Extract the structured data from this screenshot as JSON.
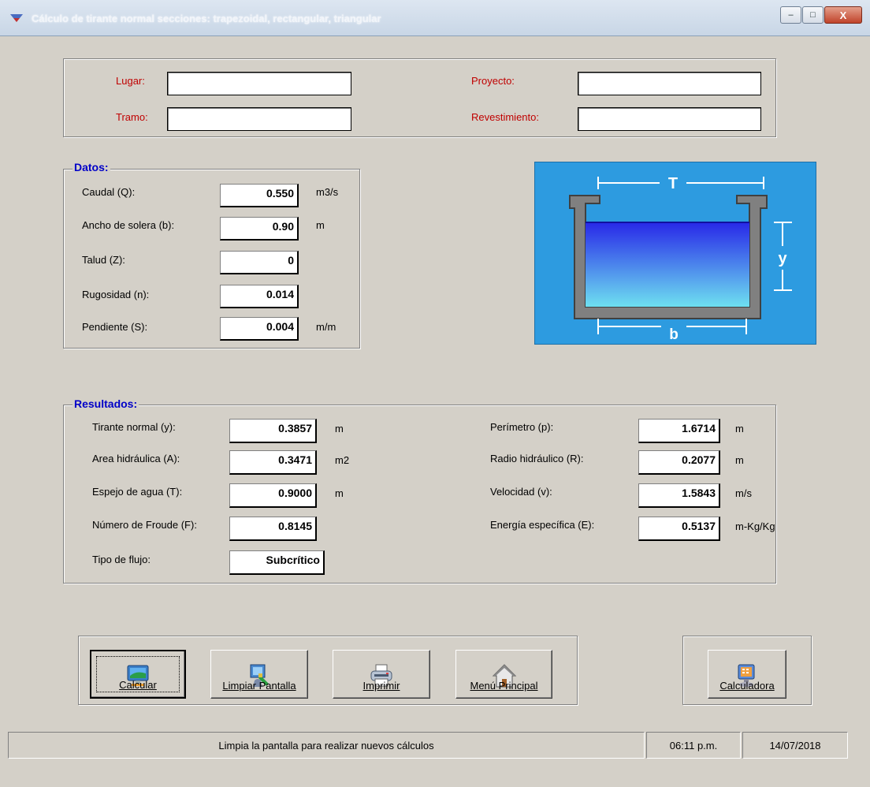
{
  "window": {
    "title": "Cálculo de tirante normal secciones: trapezoidal, rectangular, triangular",
    "minimize": "–",
    "maximize": "□",
    "close": "X"
  },
  "info": {
    "lugar_label": "Lugar:",
    "tramo_label": "Tramo:",
    "proyecto_label": "Proyecto:",
    "revestimiento_label": "Revestimiento:",
    "lugar_value": "",
    "tramo_value": "",
    "proyecto_value": "",
    "revestimiento_value": ""
  },
  "datos": {
    "title": "Datos:",
    "caudal_label": "Caudal (Q):",
    "caudal_value": "0.550",
    "caudal_unit": "m3/s",
    "ancho_label": "Ancho de solera (b):",
    "ancho_value": "0.90",
    "ancho_unit": "m",
    "talud_label": "Talud (Z):",
    "talud_value": "0",
    "rugosidad_label": "Rugosidad (n):",
    "rugosidad_value": "0.014",
    "pendiente_label": "Pendiente (S):",
    "pendiente_value": "0.004",
    "pendiente_unit": "m/m"
  },
  "diagram": {
    "top_label": "T",
    "depth_label": "y",
    "bottom_label": "b"
  },
  "resultados": {
    "title": "Resultados:",
    "tirante_label": "Tirante normal (y):",
    "tirante_value": "0.3857",
    "tirante_unit": "m",
    "area_label": "Area hidráulica (A):",
    "area_value": "0.3471",
    "area_unit": "m2",
    "espejo_label": "Espejo de agua (T):",
    "espejo_value": "0.9000",
    "espejo_unit": "m",
    "froude_label": "Número de Froude (F):",
    "froude_value": "0.8145",
    "tipo_label": "Tipo de flujo:",
    "tipo_value": "Subcrítico",
    "perimetro_label": "Perímetro (p):",
    "perimetro_value": "1.6714",
    "perimetro_unit": "m",
    "radio_label": "Radio hidráulico (R):",
    "radio_value": "0.2077",
    "radio_unit": "m",
    "velocidad_label": "Velocidad (v):",
    "velocidad_value": "1.5843",
    "velocidad_unit": "m/s",
    "energia_label": "Energía específica (E):",
    "energia_value": "0.5137",
    "energia_unit": "m-Kg/Kg"
  },
  "buttons": {
    "calcular": "Calcular",
    "limpiar": "Limpiar Pantalla",
    "imprimir": "Imprimir",
    "menu": "Menú Principal",
    "calculadora": "Calculadora"
  },
  "statusbar": {
    "message": "Limpia la pantalla para realizar nuevos cálculos",
    "time": "06:11 p.m.",
    "date": "14/07/2018"
  },
  "colors": {
    "window_bg": "#d4d0c8",
    "legend_text": "#0000c8",
    "label_red": "#c00000",
    "diagram_bg": "#2d9be0",
    "water": "#3c3cf0"
  },
  "icons": {
    "app": "app-icon",
    "calcular": "monitor-icon",
    "limpiar": "clean-screen-icon",
    "imprimir": "printer-icon",
    "menu": "house-icon",
    "calculadora": "calculator-computer-icon"
  }
}
